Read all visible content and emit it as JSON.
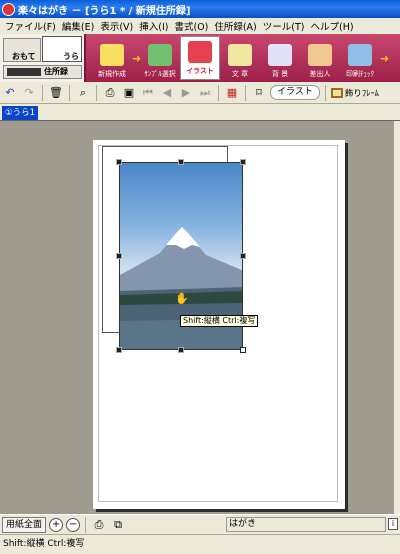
{
  "window": {
    "title": "楽々はがき － [うら1 * / 新規住所録]"
  },
  "menu": [
    "ファイル(F)",
    "編集(E)",
    "表示(V)",
    "挿入(I)",
    "書式(O)",
    "住所録(A)",
    "ツール(T)",
    "ヘルプ(H)"
  ],
  "mode": {
    "omote": "おもて",
    "ura": "うら",
    "address_book": "住所録"
  },
  "big_toolbar": {
    "items": [
      {
        "label": "新規作成",
        "icon": "new-document-icon",
        "color": "#f8e060"
      },
      {
        "label": "ｻﾝﾌﾟﾙ選択",
        "icon": "sample-select-icon",
        "color": "#70c070"
      },
      {
        "label": "イラスト",
        "icon": "flower-illustration-icon",
        "color": "#e84050"
      },
      {
        "label": "文 章",
        "icon": "text-pen-icon",
        "color": "#f0e8a0"
      },
      {
        "label": "背 景",
        "icon": "background-icon",
        "color": "#e0e0f8"
      },
      {
        "label": "差出人",
        "icon": "sender-person-icon",
        "color": "#f0c890"
      },
      {
        "label": "印刷ﾁｪｯｸ",
        "icon": "print-check-icon",
        "color": "#90c0e8"
      }
    ],
    "active": "イラスト"
  },
  "small_toolbar": {
    "object_type": "イラスト",
    "frame_label": "飾りﾌﾚｰﾑ"
  },
  "tabs": [
    {
      "label": "①うら1",
      "active": true
    }
  ],
  "tooltip": "Shift:縦横 Ctrl:複写",
  "bottom": {
    "fit_button": "用紙全面",
    "paper": "はがき"
  },
  "status": "Shift:縦横 Ctrl:複写",
  "colors": {
    "title_bar": "#0a5fd8",
    "toolbar_bg": "#b03058",
    "canvas_bg": "#a09b8f",
    "accent_arrow": "#f8c020"
  }
}
